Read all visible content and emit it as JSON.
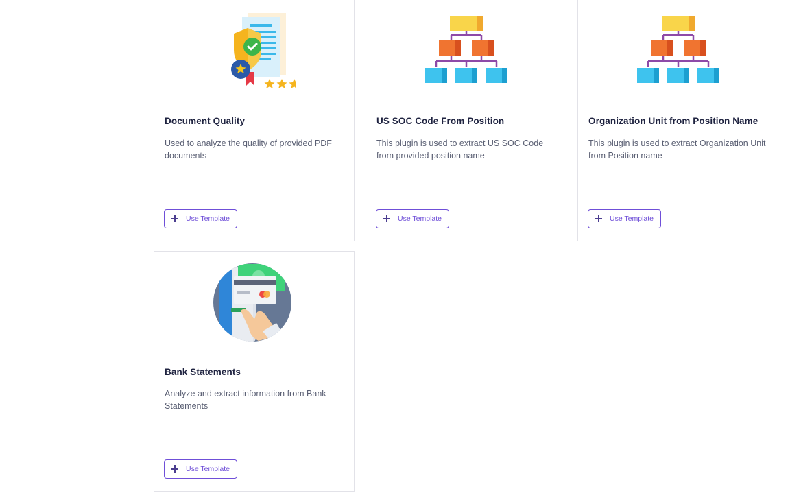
{
  "templates": [
    {
      "title": "Document Quality",
      "description": "Used to analyze the quality of provided PDF documents",
      "button_label": "Use Template",
      "illustration": "certificate-quality-icon"
    },
    {
      "title": "US SOC Code From Position",
      "description": "This plugin is used to extract US SOC Code from provided position name",
      "button_label": "Use Template",
      "illustration": "org-chart-icon"
    },
    {
      "title": "Organization Unit from Position Name",
      "description": "This plugin is used to extract Organization Unit from Position name",
      "button_label": "Use Template",
      "illustration": "org-chart-icon"
    },
    {
      "title": "Bank Statements",
      "description": "Analyze and extract information from Bank Statements",
      "button_label": "Use Template",
      "illustration": "bank-card-payment-icon"
    }
  ],
  "colors": {
    "accent": "#6f4fd8",
    "title": "#1f2340",
    "text": "#5a5f73",
    "border": "#e2e2e8"
  }
}
